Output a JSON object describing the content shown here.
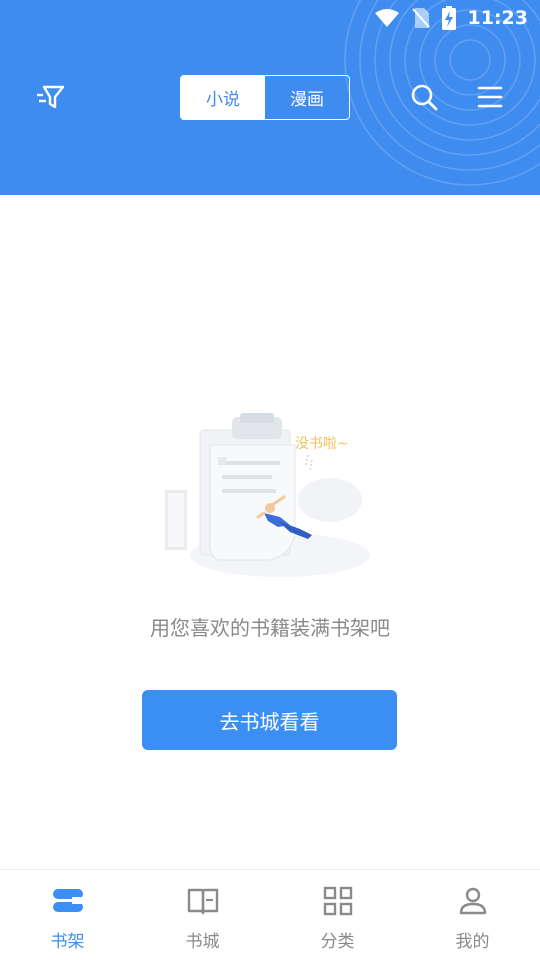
{
  "status_bar": {
    "time": "11:23"
  },
  "header": {
    "tabs": [
      {
        "label": "小说",
        "active": true
      },
      {
        "label": "漫画",
        "active": false
      }
    ],
    "icons": {
      "left": "filter-icon",
      "search": "search-icon",
      "menu": "menu-icon"
    }
  },
  "empty_state": {
    "illustration_caption": "没书啦~",
    "message": "用您喜欢的书籍装满书架吧",
    "cta_label": "去书城看看"
  },
  "bottom_nav": {
    "items": [
      {
        "label": "书架",
        "icon": "bookshelf-icon",
        "active": true
      },
      {
        "label": "书城",
        "icon": "book-icon",
        "active": false
      },
      {
        "label": "分类",
        "icon": "grid-icon",
        "active": false
      },
      {
        "label": "我的",
        "icon": "person-icon",
        "active": false
      }
    ]
  },
  "colors": {
    "primary": "#3f8cf0",
    "button": "#3b8ef3",
    "muted_text": "#8a8a8a"
  }
}
